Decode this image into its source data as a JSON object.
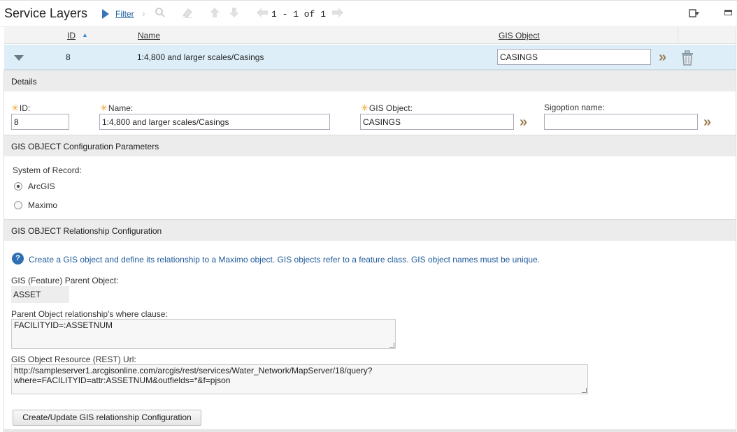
{
  "toolbar": {
    "title": "Service Layers",
    "filter_label": "Filter",
    "pager_text": "1 - 1 of 1"
  },
  "table": {
    "columns": [
      "ID",
      "Name",
      "GIS Object"
    ],
    "rows": [
      {
        "id": "8",
        "name": "1:4,800 and larger scales/Casings",
        "gis_object": "CASINGS"
      }
    ]
  },
  "details": {
    "header": "Details",
    "id_label": "ID:",
    "id_value": "8",
    "name_label": "Name:",
    "name_value": "1:4,800 and larger scales/Casings",
    "gis_label": "GIS Object:",
    "gis_value": "CASINGS",
    "sigoption_label": "Sigoption name:",
    "sigoption_value": ""
  },
  "params": {
    "header": "GIS OBJECT Configuration Parameters",
    "sor_label": "System of Record:",
    "options": [
      {
        "label": "ArcGIS",
        "selected": true
      },
      {
        "label": "Maximo",
        "selected": false
      }
    ]
  },
  "relationship": {
    "header": "GIS OBJECT Relationship Configuration",
    "help_text": "Create a GIS object and define its relationship to a Maximo object. GIS objects refer to a feature class. GIS object names must be unique.",
    "parent_label": "GIS (Feature) Parent Object:",
    "parent_value": "ASSET",
    "where_label": "Parent Object relationship's where clause:",
    "where_value": "FACILITYID=:ASSETNUM",
    "rest_label": "GIS Object Resource (REST) Url:",
    "rest_value": "http://sampleserver1.arcgisonline.com/arcgis/rest/services/Water_Network/MapServer/18/query?\nwhere=FACILITYID=attr:ASSETNUM&outfields=*&f=pjson",
    "button_label": "Create/Update GIS relationship Configuration"
  },
  "colors": {
    "accent": "#1d5fa3",
    "row_selected": "#ddeef8",
    "required": "#e8a12a",
    "lookup_arrow": "#9a7d52"
  },
  "icons": [
    "filter-icon",
    "search-icon",
    "eraser-icon",
    "arrow-up-icon",
    "arrow-down-icon",
    "prev-page-icon",
    "next-page-icon",
    "download-icon",
    "minimize-icon",
    "sort-asc-icon",
    "row-toggle-icon",
    "lookup-arrow-icon",
    "trash-icon",
    "help-icon"
  ]
}
